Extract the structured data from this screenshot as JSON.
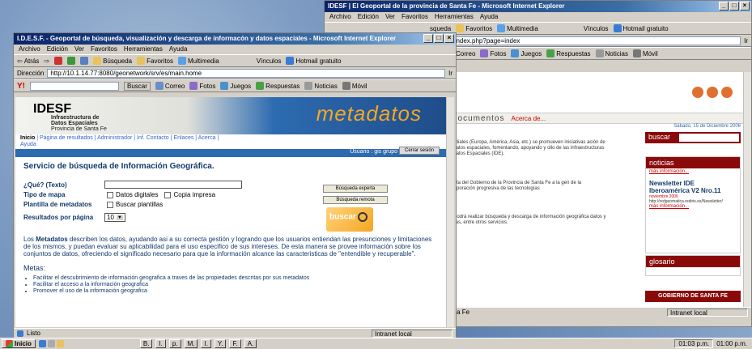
{
  "right_window": {
    "title": "IDESF | El Geoportal de la provincia de Santa Fe - Microsoft Internet Explorer",
    "menu": [
      "Archivo",
      "Edición",
      "Ver",
      "Favoritos",
      "Herramientas",
      "Ayuda"
    ],
    "toolbar": [
      "squeda",
      "Favoritos",
      "Multimedia",
      "Vínculos",
      "Hotmail gratuito"
    ],
    "address": "a/index.php?page=index",
    "go_label": "Ir",
    "links_bar": [
      "Correo",
      "Fotos",
      "Juegos",
      "Respuestas",
      "Noticias",
      "Móvil"
    ],
    "nav_docs": "documentos",
    "nav_about": "Acerca de...",
    "date": "Sábado, 15 de Diciembre 2006",
    "buscar_label": "buscar",
    "para1": "mundiales (Europa, América, Asia, etc.) se promueven iniciativas ación de los datos espaciales, fomentando, apoyando y ollo de las Infraestructuras de Datos Espaciales (IDE).",
    "para2": "puesta del Gobierno de la Provincia de Santa Fe a la gen de la incorporación progresiva de las tecnologías",
    "para3": "ted podrá realizar búsqueda y descarga de información geográfica datos y mapas, entre otros servicios.",
    "noticias_title": "noticias",
    "mas_info_1": "más información...",
    "news_title": "Newsletter IDE Iberoamérica V2 Nro.11",
    "news_date": "noviembre 2006",
    "news_url": "http://redgeomatica.rediris.es/Newsletter/",
    "mas_info_2": "más información...",
    "glosario_title": "glosario",
    "gobierno": "GOBIERNO DE SANTA FE",
    "status_left": "anta Fe",
    "status_zone": "Intranet local"
  },
  "left_window": {
    "title": "I.D.E.S.F. - Geoportal de búsqueda, visualización y descarga de informacón y datos espaciales - Microsoft Internet Explorer",
    "menu": [
      "Archivo",
      "Edición",
      "Ver",
      "Favoritos",
      "Herramientas",
      "Ayuda"
    ],
    "toolbar": [
      "Atrás",
      "Búsqueda",
      "Favoritos",
      "Multimedia",
      "Vínculos",
      "Hotmail gratuito"
    ],
    "address_label": "Dirección",
    "address": "http://10.1.14.77:8080/geonetwork/srv/es/main.home",
    "go_label": "Ir",
    "yahoo_search_label": "Buscar",
    "links_bar": [
      "Correo",
      "Fotos",
      "Juegos",
      "Respuestas",
      "Noticias",
      "Móvil"
    ],
    "logo": "IDESF",
    "logo_sub": [
      "Infraestructura de",
      "Datos Espaciales",
      "Provincia de Santa Fe"
    ],
    "metadatos_logo": "metadatos",
    "nav": [
      "Inicio",
      "Página de resultados",
      "Administrador",
      "Inf. Contacto",
      "Enlaces",
      "Acerca",
      "Ayuda"
    ],
    "user": "Usuario : gis grupo",
    "cerrar_sesion": "Cerrar sesión",
    "form_title": "Servicio de búsqueda de Información Geográfica.",
    "que_label": "¿Qué? (Texto)",
    "tipo_label": "Tipo de mapa",
    "tipo_opts": [
      "Datos digitales",
      "Copia impresa"
    ],
    "plantilla_label": "Plantilla de metadatos",
    "plantilla_opt": "Buscar plantillas",
    "resultados_label": "Resultados por página",
    "resultados_value": "10",
    "busqueda_experta": "Búsqueda experta",
    "busqueda_remota": "Búsqueda remota",
    "buscar_img": "buscar",
    "desc_bold": "Metadatos",
    "desc_pre": "Los ",
    "desc": " describen los datos, ayudando asi a su correcta gestión y logrando que los usuarios entiendan las presunciones y limitaciones de los mismos, y puedan evaluar su aplicabilidad para el uso especifico de sus intereses. De esta manera se provee información sobre los conjuntos de datos, ofreciendo el significado necesario para que la información alcance las caracteristicas de \"entendible y recuperable\".",
    "metas_title": "Metas:",
    "metas": [
      "Facilitar el descubrimiento de información geografica a traves de las propiedades descritas por sus metadatos",
      "Facilitar el acceso a la información geografica",
      "Promover el uso de la información geografica"
    ],
    "status_left": "Listo",
    "status_zone": "Intranet local"
  },
  "taskbar": {
    "start": "Inicio",
    "tasks": [
      "B.",
      "I.",
      "p.",
      "M.",
      "I.",
      "Y.",
      "F.",
      "A."
    ],
    "clock": "01:03 p.m.",
    "clock_right": "01:00 p.m."
  }
}
